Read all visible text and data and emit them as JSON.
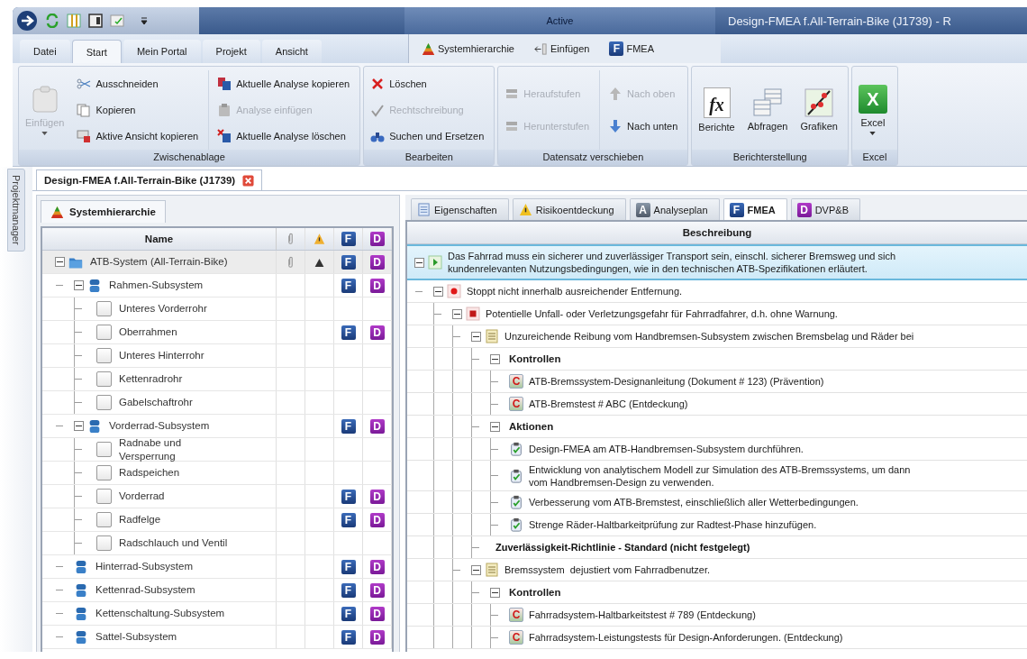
{
  "window": {
    "title": "Design-FMEA f.All-Terrain-Bike (J1739) - R",
    "context_header": "Active"
  },
  "ribbon": {
    "tabs": [
      {
        "label": "Datei",
        "selected": false
      },
      {
        "label": "Start",
        "selected": true
      },
      {
        "label": "Mein Portal",
        "selected": false
      },
      {
        "label": "Projekt",
        "selected": false
      },
      {
        "label": "Ansicht",
        "selected": false
      }
    ],
    "context_tabs": [
      {
        "label": "Systemhierarchie",
        "selected": false
      },
      {
        "label": "Einfügen",
        "selected": false
      },
      {
        "label": "FMEA",
        "badge": "F",
        "selected": false
      }
    ],
    "groups": [
      {
        "label": "Zwischenablage",
        "columns": [
          [
            {
              "label": "Einfügen",
              "kind": "large",
              "disabled": true,
              "dropdown": true
            }
          ],
          [
            {
              "label": "Ausschneiden",
              "kind": "small",
              "disabled": false
            },
            {
              "label": "Kopieren",
              "kind": "small",
              "disabled": false
            },
            {
              "label": "Aktive Ansicht kopieren",
              "kind": "small",
              "disabled": false
            }
          ],
          [
            {
              "label": "Aktuelle Analyse kopieren",
              "kind": "small",
              "disabled": false
            },
            {
              "label": "Analyse einfügen",
              "kind": "small",
              "disabled": true
            },
            {
              "label": "Aktuelle Analyse löschen",
              "kind": "small",
              "disabled": false
            }
          ]
        ]
      },
      {
        "label": "Bearbeiten",
        "columns": [
          [
            {
              "label": "Löschen",
              "kind": "small",
              "disabled": false
            },
            {
              "label": "Rechtschreibung",
              "kind": "small",
              "disabled": true
            },
            {
              "label": "Suchen und Ersetzen",
              "kind": "small",
              "disabled": false
            }
          ]
        ]
      },
      {
        "label": "Datensatz verschieben",
        "columns": [
          [
            {
              "label": "Heraufstufen",
              "kind": "small",
              "disabled": true
            },
            {
              "label": "Herunterstufen",
              "kind": "small",
              "disabled": true
            }
          ],
          [
            {
              "label": "Nach oben",
              "kind": "small",
              "disabled": true
            },
            {
              "label": "Nach unten",
              "kind": "small",
              "disabled": false
            }
          ]
        ]
      },
      {
        "label": "Berichterstellung",
        "columns": [
          [
            {
              "label": "Berichte",
              "kind": "large",
              "badge": "fx",
              "disabled": false,
              "dropdown": false
            }
          ],
          [
            {
              "label": "Abfragen",
              "kind": "large",
              "disabled": false,
              "dropdown": false
            }
          ],
          [
            {
              "label": "Grafiken",
              "kind": "large",
              "disabled": false,
              "dropdown": false
            }
          ]
        ]
      },
      {
        "label": "Excel",
        "columns": [
          [
            {
              "label": "Excel",
              "kind": "large",
              "badge": "X",
              "disabled": false,
              "dropdown": true
            }
          ]
        ]
      }
    ]
  },
  "side_tab": {
    "label": "Projektmanager"
  },
  "document_tab": {
    "title": "Design-FMEA f.All-Terrain-Bike (J1739)",
    "selected": true
  },
  "hierarchy": {
    "tab": {
      "label": "Systemhierarchie",
      "selected": true
    },
    "columns": [
      {
        "kind": "name",
        "label": "Name"
      },
      {
        "kind": "attachment"
      },
      {
        "kind": "warning"
      },
      {
        "kind": "fmea",
        "label": "F"
      },
      {
        "kind": "dvp",
        "label": "D"
      }
    ],
    "rows": [
      {
        "name": "ATB-System (All-Terrain-Bike)",
        "kind": "system",
        "selected": true,
        "attachment": true,
        "warning": true,
        "fmea": "F",
        "dvp": "D",
        "expanded": true,
        "children": [
          {
            "name": "Rahmen-Subsystem",
            "kind": "subsystem",
            "selected": false,
            "attachment": false,
            "warning": false,
            "fmea": "F",
            "dvp": "D",
            "expanded": true,
            "children": [
              {
                "name": "Unteres Vorderrohr",
                "kind": "component",
                "selected": false,
                "attachment": false,
                "warning": false
              },
              {
                "name": "Oberrahmen",
                "kind": "component",
                "selected": false,
                "attachment": false,
                "warning": false,
                "fmea": "F",
                "dvp": "D"
              },
              {
                "name": "Unteres Hinterrohr",
                "kind": "component",
                "selected": false,
                "attachment": false,
                "warning": false
              },
              {
                "name": "Kettenradrohr",
                "kind": "component",
                "selected": false,
                "attachment": false,
                "warning": false
              },
              {
                "name": "Gabelschaftrohr",
                "kind": "component",
                "selected": false,
                "attachment": false,
                "warning": false
              }
            ]
          },
          {
            "name": "Vorderrad-Subsystem",
            "kind": "subsystem",
            "selected": false,
            "attachment": false,
            "warning": false,
            "fmea": "F",
            "dvp": "D",
            "expanded": true,
            "children": [
              {
                "name": "Radnabe und\nVersperrung",
                "kind": "component",
                "selected": false,
                "attachment": false,
                "warning": false
              },
              {
                "name": "Radspeichen",
                "kind": "component",
                "selected": false,
                "attachment": false,
                "warning": false
              },
              {
                "name": "Vorderrad",
                "kind": "component",
                "selected": false,
                "attachment": false,
                "warning": false,
                "fmea": "F",
                "dvp": "D"
              },
              {
                "name": "Radfelge",
                "kind": "component",
                "selected": false,
                "attachment": false,
                "warning": false,
                "fmea": "F",
                "dvp": "D"
              },
              {
                "name": "Radschlauch und Ventil",
                "kind": "component",
                "selected": false,
                "attachment": false,
                "warning": false
              }
            ]
          },
          {
            "name": "Hinterrad-Subsystem",
            "kind": "subsystem",
            "selected": false,
            "attachment": false,
            "warning": false,
            "fmea": "F",
            "dvp": "D"
          },
          {
            "name": "Kettenrad-Subsystem",
            "kind": "subsystem",
            "selected": false,
            "attachment": false,
            "warning": false,
            "fmea": "F",
            "dvp": "D"
          },
          {
            "name": "Kettenschaltung-Subsystem",
            "kind": "subsystem",
            "selected": false,
            "attachment": false,
            "warning": false,
            "fmea": "F",
            "dvp": "D"
          },
          {
            "name": "Sattel-Subsystem",
            "kind": "subsystem",
            "selected": false,
            "attachment": false,
            "warning": false,
            "fmea": "F",
            "dvp": "D"
          }
        ]
      }
    ]
  },
  "analysis": {
    "tabs": [
      {
        "label": "Eigenschaften",
        "kind": "properties",
        "selected": false
      },
      {
        "label": "Risikoentdeckung",
        "kind": "risk",
        "selected": false
      },
      {
        "label": "Analyseplan",
        "kind": "plan",
        "badge": "A",
        "selected": false
      },
      {
        "label": "FMEA",
        "kind": "fmea",
        "badge": "F",
        "selected": true
      },
      {
        "label": "DVP&B",
        "kind": "dvp",
        "badge": "D",
        "selected": false
      }
    ],
    "column": "Beschreibung",
    "rows": [
      {
        "text": "Das Fahrrad muss ein sicherer und zuverlässiger Transport sein, einschl. sicherer Bremsweg und sich\nkundenrelevanten Nutzungsbedingungen, wie in den technischen ATB-Spezifikationen erläutert.",
        "kind": "function",
        "selected": true,
        "expanded": true,
        "children": [
          {
            "text": "Stoppt nicht innerhalb ausreichender Entfernung.",
            "kind": "failure",
            "selected": false,
            "expanded": true,
            "children": [
              {
                "text": "Potentielle Unfall- oder Verletzungsgefahr für Fahrradfahrer, d.h. ohne Warnung.",
                "kind": "effect",
                "selected": false,
                "expanded": true,
                "children": [
                  {
                    "text": "Unzureichende Reibung vom Handbremsen-Subsystem zwischen Bremsbelag und Räder bei",
                    "kind": "cause",
                    "selected": false,
                    "expanded": true,
                    "children": [
                      {
                        "text": "Kontrollen",
                        "kind": "group",
                        "selected": false,
                        "expanded": true,
                        "children": [
                          {
                            "text": "ATB-Bremssystem-Designanleitung (Dokument # 123) (Prävention)",
                            "kind": "control",
                            "badge": "C",
                            "selected": false
                          },
                          {
                            "text": "ATB-Bremstest # ABC (Entdeckung)",
                            "kind": "control",
                            "badge": "C",
                            "selected": false
                          }
                        ]
                      },
                      {
                        "text": "Aktionen",
                        "kind": "group",
                        "selected": false,
                        "expanded": true,
                        "children": [
                          {
                            "text": "Design-FMEA am ATB-Handbremsen-Subsystem durchführen.",
                            "kind": "action",
                            "selected": false
                          },
                          {
                            "text": "Entwicklung von analytischem Modell zur Simulation des ATB-Bremssystems, um dann\nvom Handbremsen-Design zu verwenden.",
                            "kind": "action",
                            "selected": false
                          },
                          {
                            "text": "Verbesserung vom ATB-Bremstest, einschließlich aller Wetterbedingungen.",
                            "kind": "action",
                            "selected": false
                          },
                          {
                            "text": "Strenge Räder-Haltbarkeitprüfung zur Radtest-Phase hinzufügen.",
                            "kind": "action",
                            "selected": false
                          }
                        ]
                      },
                      {
                        "text": "Zuverlässigkeit-Richtlinie - Standard (nicht festgelegt)",
                        "kind": "guideline",
                        "selected": false
                      }
                    ]
                  },
                  {
                    "text": "Bremssystem  dejustiert vom Fahrradbenutzer.",
                    "kind": "cause",
                    "selected": false,
                    "expanded": true,
                    "children": [
                      {
                        "text": "Kontrollen",
                        "kind": "group",
                        "selected": false,
                        "expanded": true,
                        "children": [
                          {
                            "text": "Fahrradsystem-Haltbarkeitstest # 789 (Entdeckung)",
                            "kind": "control",
                            "badge": "C",
                            "selected": false
                          },
                          {
                            "text": "Fahrradsystem-Leistungstests für Design-Anforderungen. (Entdeckung)",
                            "kind": "control",
                            "badge": "C",
                            "selected": false
                          }
                        ]
                      }
                    ]
                  }
                ]
              }
            ]
          }
        ]
      }
    ]
  }
}
